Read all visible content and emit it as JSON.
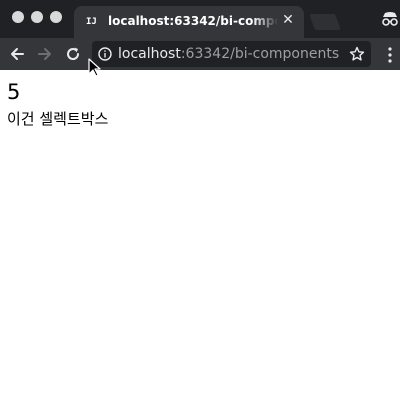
{
  "browser": {
    "tab": {
      "favicon_text": "IJ",
      "title": "localhost:63342/bi-components",
      "close_glyph": "✕"
    },
    "address_bar": {
      "host": "localhost",
      "rest": ":63342/bi-components..."
    },
    "colors": {
      "tabbar": "#1f2124",
      "toolbar": "#35363a",
      "omnibox": "#202124"
    }
  },
  "page": {
    "value": "5",
    "select_label": "이건 셀렉트박스"
  }
}
